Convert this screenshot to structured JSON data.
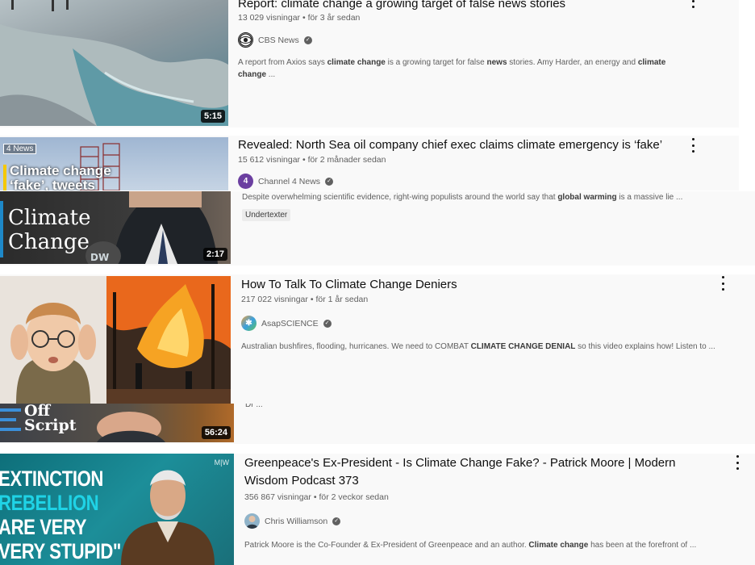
{
  "videos": [
    {
      "title": "Report: climate change a growing target of false news stories",
      "views": "13 029 visningar",
      "age": "för 3 år sedan",
      "channel": "CBS News",
      "desc_parts": [
        "A report from Axios says ",
        "climate change",
        " is a growing target for false ",
        "news",
        " stories. Amy Harder, an energy and ",
        "climate change",
        " ..."
      ],
      "duration": "5:15"
    },
    {
      "title": "Revealed: North Sea oil company chief exec claims climate emergency is ‘fake’",
      "views": "15 612 visningar",
      "age": "för 2 månader sedan",
      "channel": "Channel 4 News",
      "thumb_brand": "News",
      "thumb_text_1": "Climate change",
      "thumb_text_2": "‘fake’, tweets"
    },
    {
      "desc_parts": [
        "Despite overwhelming scientific evidence, right-wing populists around the world say that ",
        "global warming",
        " is a massive lie ..."
      ],
      "badge": "Undertexter",
      "thumb_text_1": "Climate",
      "thumb_text_2": "Change",
      "duration": "2:17"
    },
    {
      "title": "How To Talk To Climate Change Deniers",
      "views": "217 022 visningar",
      "age": "för 1 år sedan",
      "channel": "AsapSCIENCE",
      "desc_parts": [
        "Australian bushfires, flooding, hurricanes. We need to COMBAT ",
        "CLIMATE CHANGE DENIAL",
        " so this video explains how! Listen to ..."
      ]
    },
    {
      "partial_desc": "Dr ...",
      "thumb_text_1": "Off",
      "thumb_text_2": "Script",
      "duration": "56:24"
    },
    {
      "title": "Greenpeace's Ex-President - Is Climate Change Fake? - Patrick Moore | Modern Wisdom Podcast 373",
      "views": "356 867 visningar",
      "age": "för 2 veckor sedan",
      "channel": "Chris Williamson",
      "desc_parts": [
        "Patrick Moore is the Co-Founder & Ex-President of Greenpeace and an author. ",
        "Climate change",
        " has been at the forefront of ..."
      ],
      "thumb_corner": "M|W",
      "thumb_lines": [
        "EXTINCTION",
        "REBELLION",
        "ARE VERY",
        "VERY STUPID\""
      ]
    }
  ],
  "sep": "•",
  "icons": {
    "menu": "more-vert-icon",
    "verified": "verified-check-icon"
  },
  "colors": {
    "accent_teal": "#1fb7c9",
    "channel4": "#6b3fa0",
    "dw_blue": "#1e88c8",
    "bg": "#f9f9f9"
  }
}
